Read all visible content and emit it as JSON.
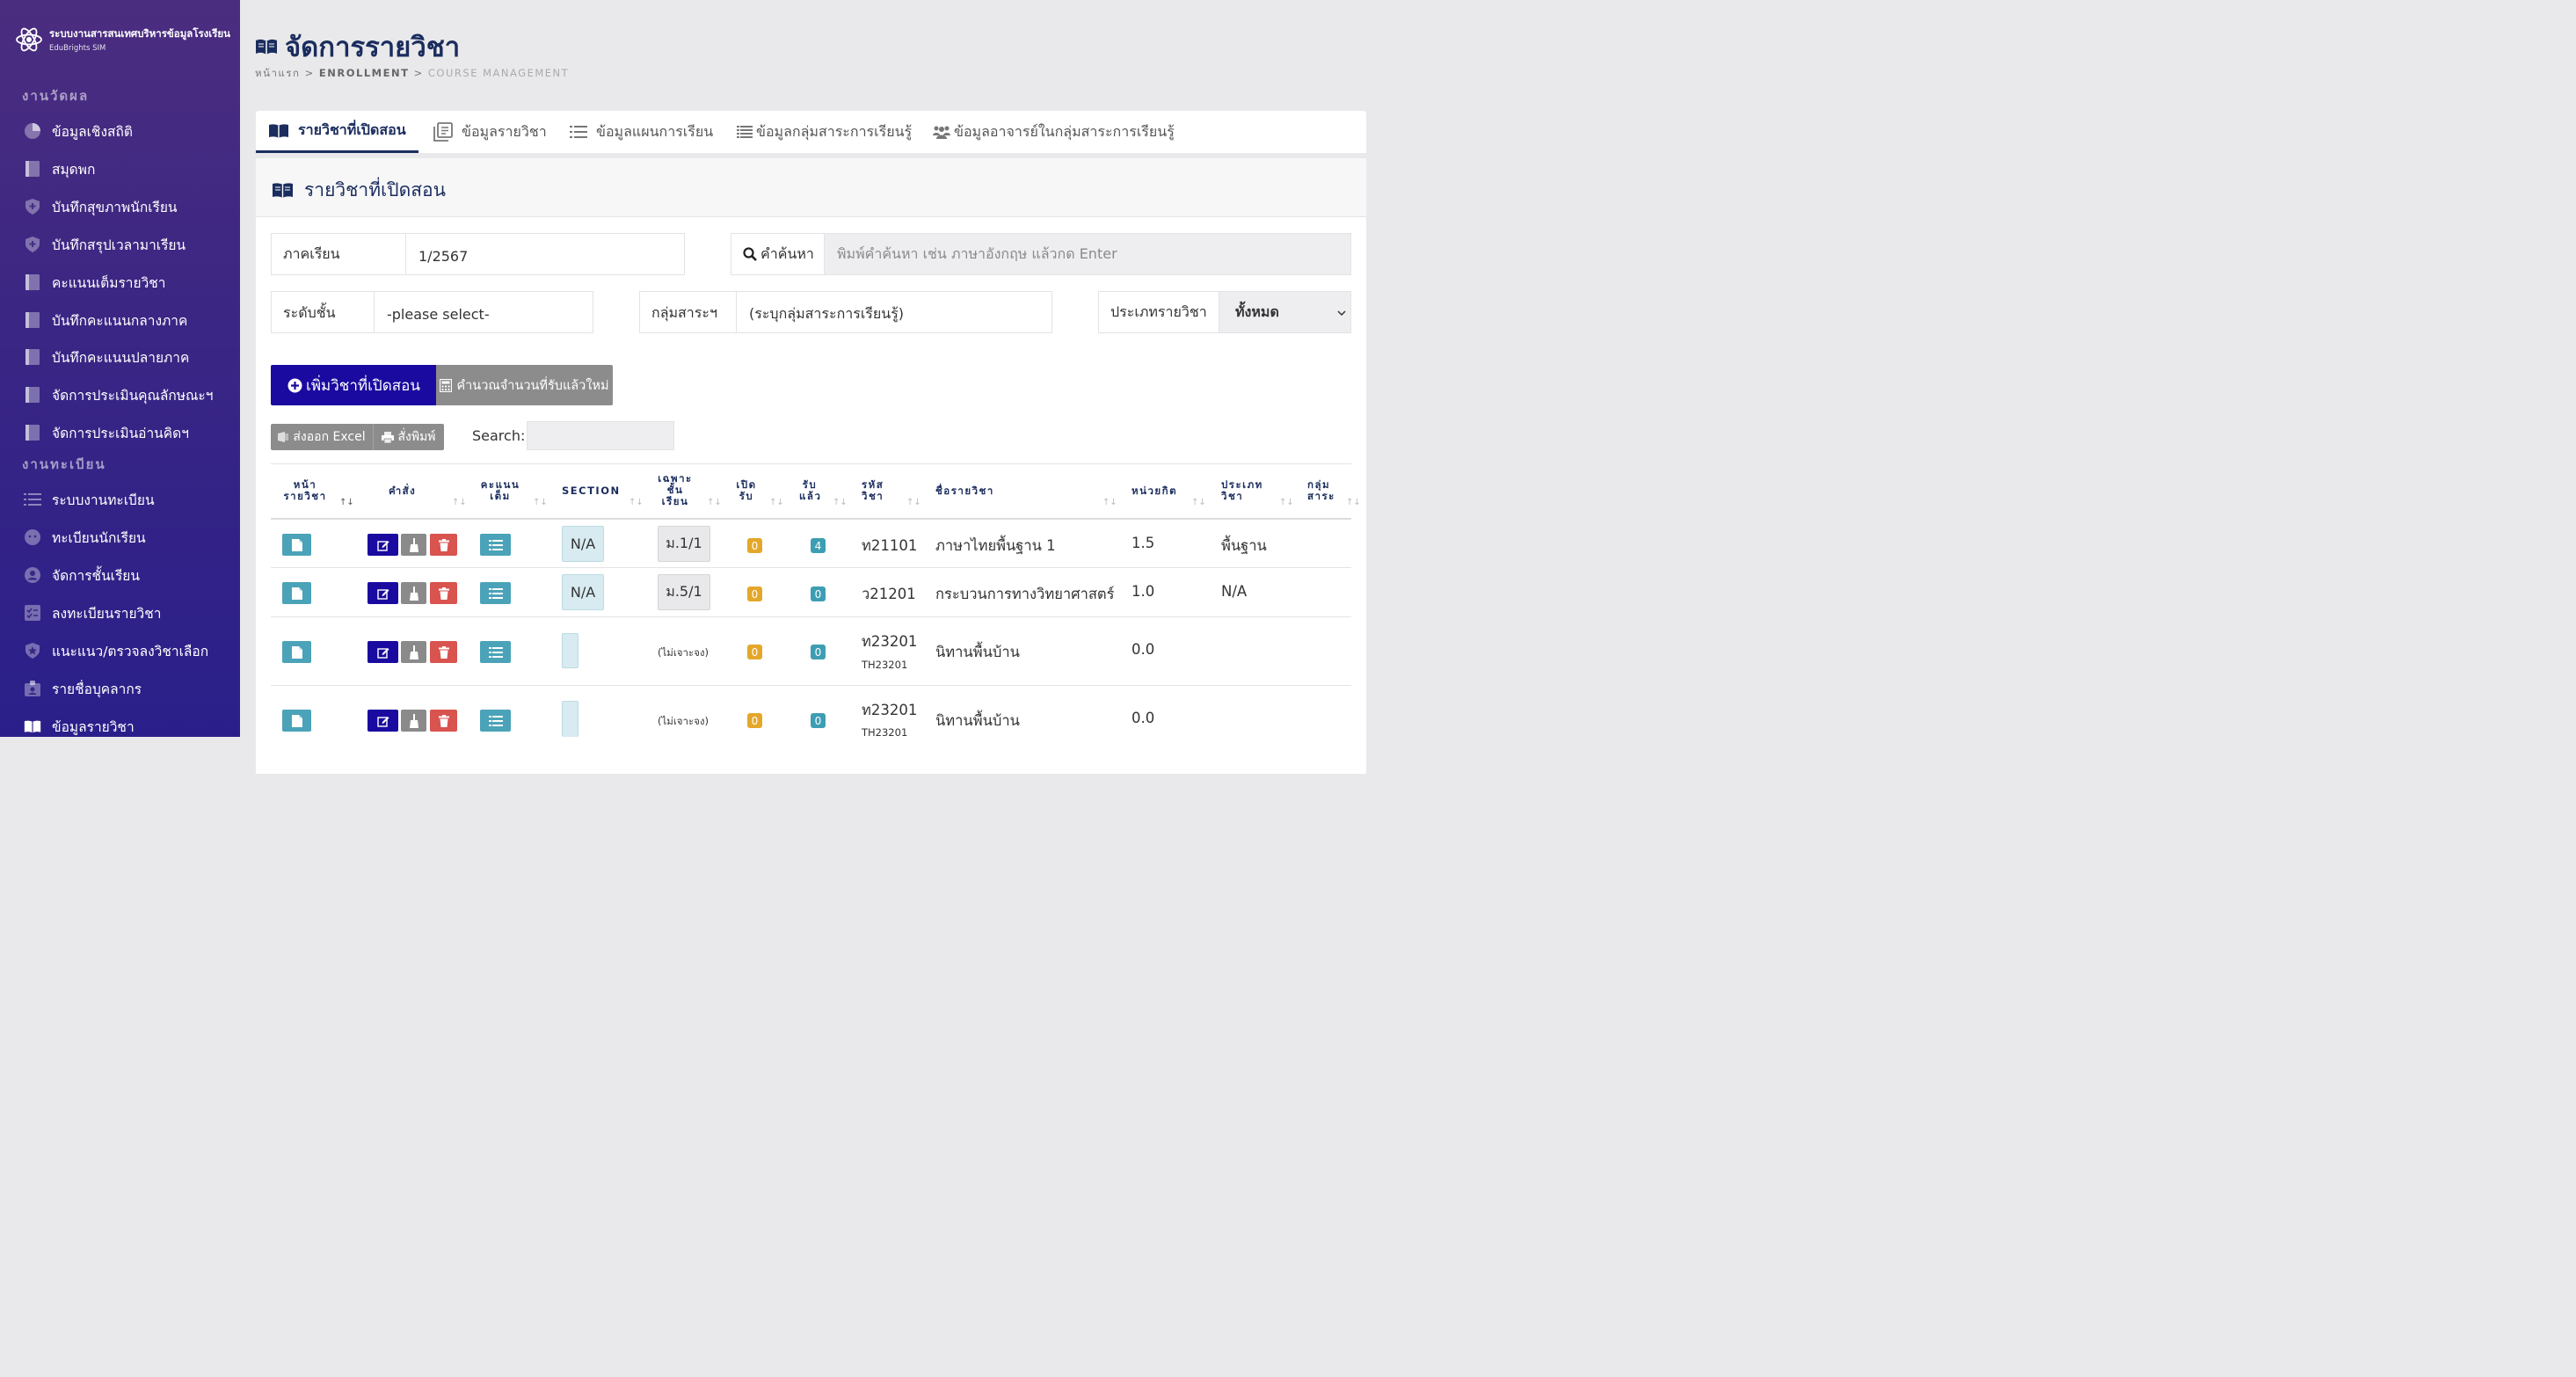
{
  "brand": {
    "title": "ระบบงานสารสนเทศบริหารข้อมูลโรงเรียน",
    "subtitle": "EduBrights SIM"
  },
  "sidebar": {
    "section1": "งานวัดผล",
    "section2": "งานทะเบียน",
    "items": [
      {
        "label": "ข้อมูลเชิงสถิติ",
        "icon": "chart-pie-icon"
      },
      {
        "label": "สมุดพก",
        "icon": "book-icon"
      },
      {
        "label": "บันทึกสุขภาพนักเรียน",
        "icon": "shield-icon"
      },
      {
        "label": "บันทึกสรุปเวลามาเรียน",
        "icon": "shield-icon"
      },
      {
        "label": "คะแนนเต็มรายวิชา",
        "icon": "book-icon"
      },
      {
        "label": "บันทึกคะแนนกลางภาค",
        "icon": "book-icon"
      },
      {
        "label": "บันทึกคะแนนปลายภาค",
        "icon": "book-icon"
      },
      {
        "label": "จัดการประเมินคุณลักษณะฯ",
        "icon": "book-icon"
      },
      {
        "label": "จัดการประเมินอ่านคิดฯ",
        "icon": "book-icon"
      },
      {
        "label": "ระบบงานทะเบียน",
        "icon": "list-icon"
      },
      {
        "label": "ทะเบียนนักเรียน",
        "icon": "face-icon"
      },
      {
        "label": "จัดการชั้นเรียน",
        "icon": "user-circle-icon"
      },
      {
        "label": "ลงทะเบียนรายวิชา",
        "icon": "checklist-icon"
      },
      {
        "label": "แนะแนว/ตรวจลงวิชาเลือก",
        "icon": "star-shield-icon"
      },
      {
        "label": "รายชื่อบุคลากร",
        "icon": "id-badge-icon"
      },
      {
        "label": "ข้อมูลรายวิชา",
        "icon": "open-book-icon"
      }
    ]
  },
  "header": {
    "title": "จัดการรายวิชา",
    "breadcrumb": {
      "home": "หน้าแรก",
      "sep": ">",
      "mid": "ENROLLMENT",
      "current": "COURSE MANAGEMENT"
    }
  },
  "tabs": [
    {
      "label": "รายวิชาที่เปิดสอน",
      "active": true
    },
    {
      "label": "ข้อมูลรายวิชา"
    },
    {
      "label": "ข้อมูลแผนการเรียน"
    },
    {
      "label": "ข้อมูลกลุ่มสาระการเรียนรู้"
    },
    {
      "label": "ข้อมูลอาจารย์ในกลุ่มสาระการเรียนรู้"
    }
  ],
  "card": {
    "title": "รายวิชาที่เปิดสอน"
  },
  "filters": {
    "semester_label": "ภาคเรียน",
    "semester_value": "1/2567",
    "search_label": "คำค้นหา",
    "search_placeholder": "พิมพ์คำค้นหา เช่น ภาษาอังกฤษ แล้วกด Enter",
    "level_label": "ระดับชั้น",
    "level_value": "-please select-",
    "group_label": "กลุ่มสาระฯ",
    "group_value": "(ระบุกลุ่มสาระการเรียนรู้)",
    "type_label": "ประเภทรายวิชา",
    "type_value": "ทั้งหมด"
  },
  "actions": {
    "add_course": "เพิ่มวิชาที่เปิดสอน",
    "recalc": "คำนวณจำนวนที่รับแล้วใหม่",
    "export_excel": "ส่งออก Excel",
    "print": "สั่งพิมพ์",
    "search_label": "Search:"
  },
  "table": {
    "headers": {
      "page": [
        "หน้า",
        "รายวิชา"
      ],
      "command": "คำสั่ง",
      "fullscore": [
        "คะแนน",
        "เต็ม"
      ],
      "section": "SECTION",
      "only_class": [
        "เฉพาะ",
        "ชั้น",
        "เรียน"
      ],
      "open": [
        "เปิด",
        "รับ"
      ],
      "received": [
        "รับ",
        "แล้ว"
      ],
      "code": [
        "รหัส",
        "วิชา"
      ],
      "name": "ชื่อรายวิชา",
      "credit": "หน่วยกิต",
      "type": [
        "ประเภท",
        "วิชา"
      ],
      "group": [
        "กลุ่ม",
        "สาระ"
      ]
    },
    "rows": [
      {
        "section": "N/A",
        "class": "ม.1/1",
        "open": "0",
        "received": "4",
        "code": "ท21101",
        "code_en": "",
        "name": "ภาษาไทยพื้นฐาน 1",
        "credit": "1.5",
        "type": "พื้นฐาน"
      },
      {
        "section": "N/A",
        "class": "ม.5/1",
        "open": "0",
        "received": "0",
        "code": "ว21201",
        "code_en": "",
        "name": "กระบวนการทางวิทยาศาสตร์",
        "credit": "1.0",
        "type": "N/A"
      },
      {
        "section": "",
        "class": "(ไม่เจาะจง)",
        "open": "0",
        "received": "0",
        "code": "ท23201",
        "code_en": "TH23201",
        "name": "นิทานพื้นบ้าน",
        "credit": "0.0",
        "type": ""
      },
      {
        "section": "",
        "class": "(ไม่เจาะจง)",
        "open": "0",
        "received": "0",
        "code": "ท23201",
        "code_en": "TH23201",
        "name": "นิทานพื้นบ้าน",
        "credit": "0.0",
        "type": ""
      }
    ]
  }
}
